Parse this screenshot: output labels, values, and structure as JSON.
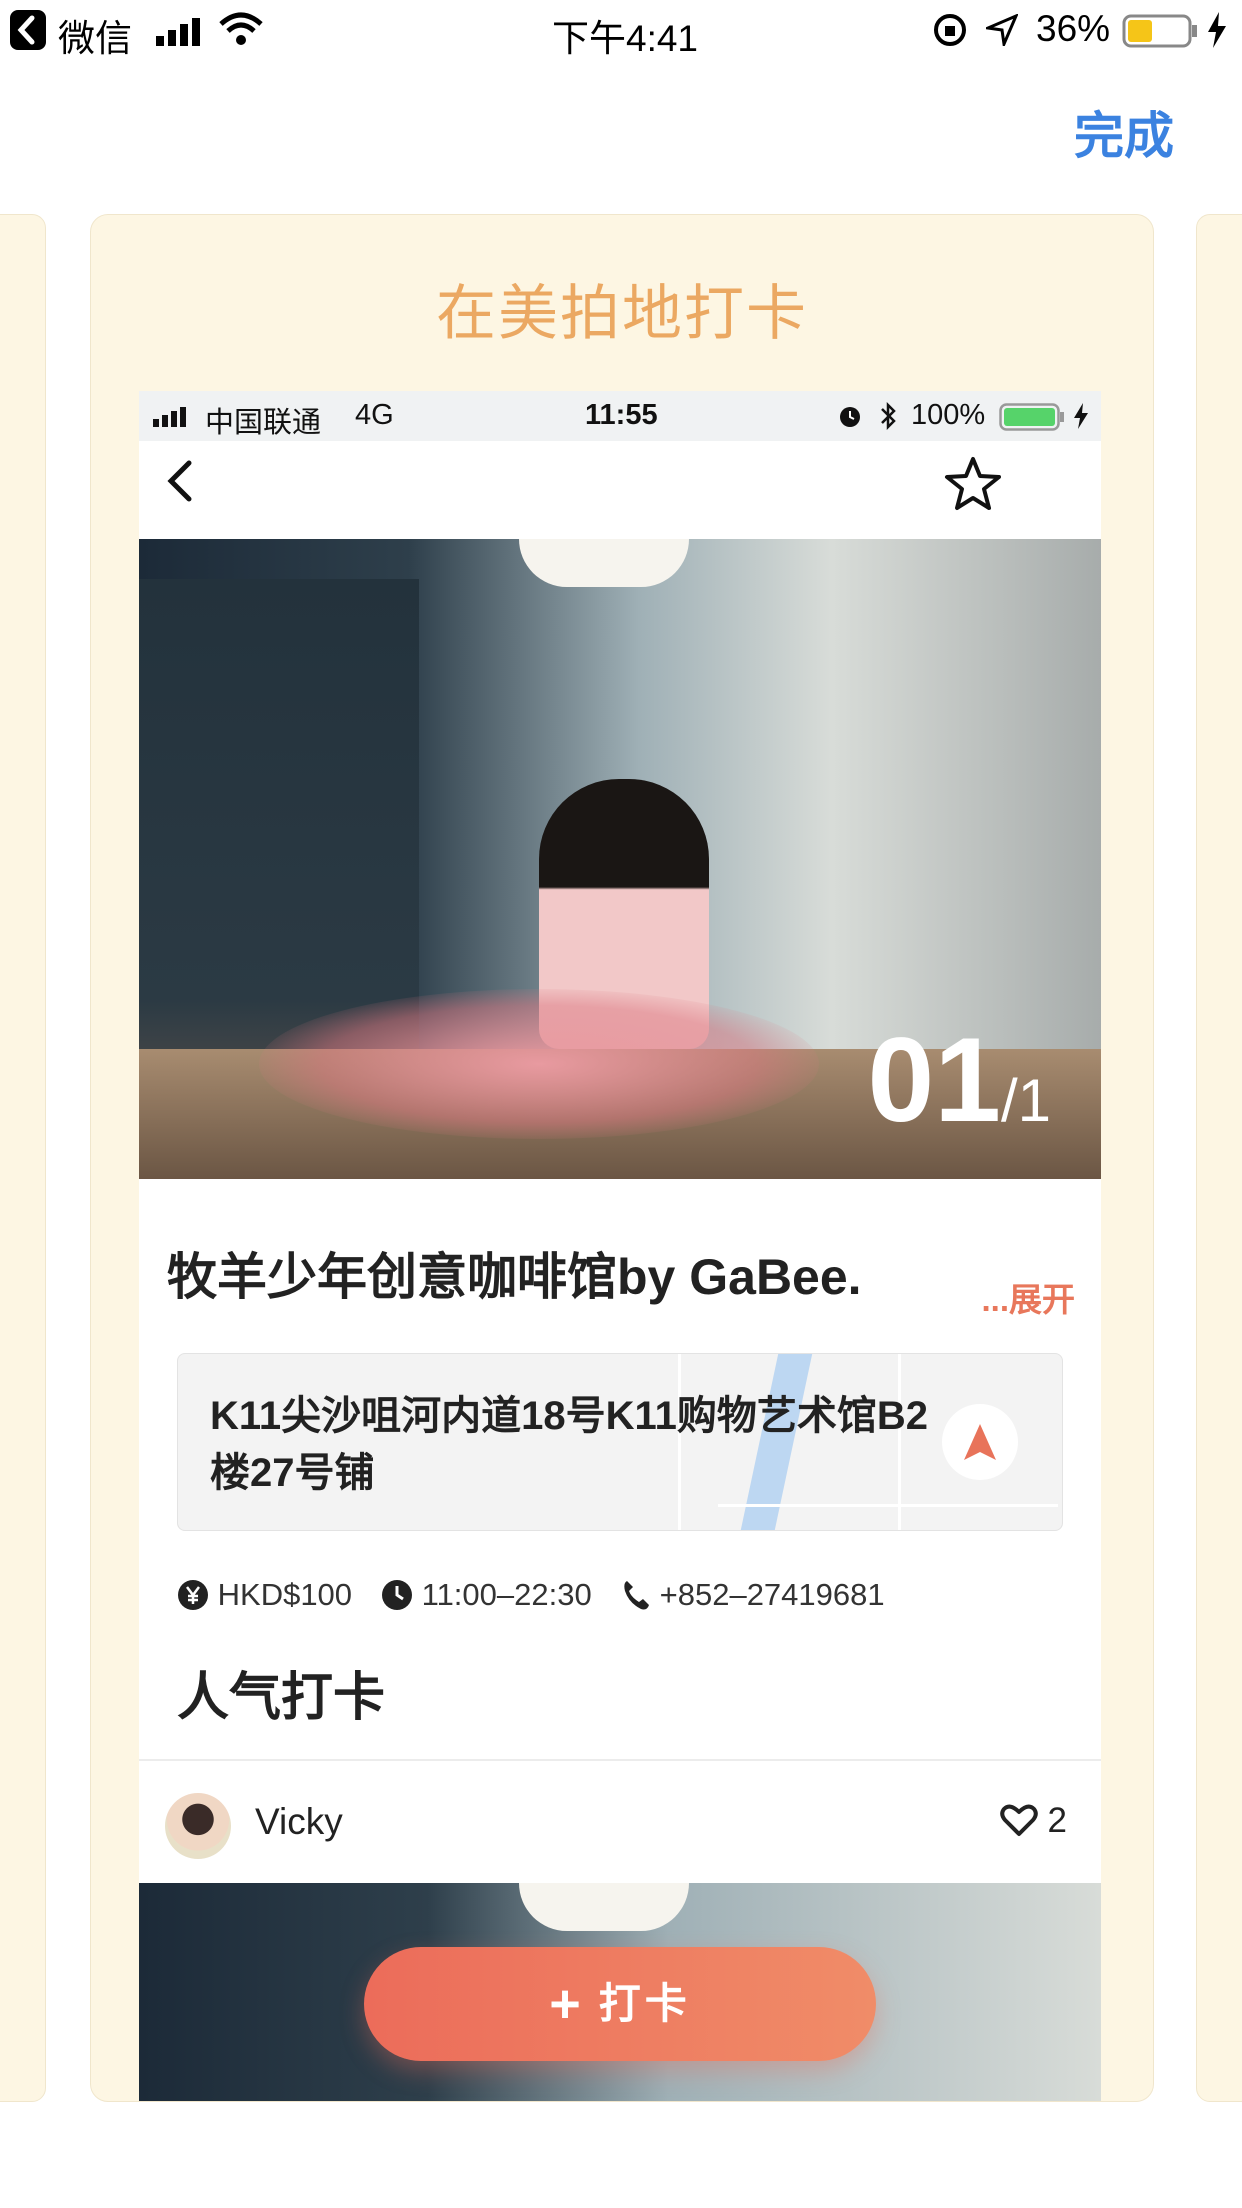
{
  "status_bar": {
    "back_app": "微信",
    "time": "下午4:41",
    "battery": "36%"
  },
  "header": {
    "done_label": "完成"
  },
  "card": {
    "title": "在美拍地打卡",
    "inner_status": {
      "carrier": "中国联通",
      "network": "4G",
      "time": "11:55",
      "battery": "100%"
    },
    "photo_counter": {
      "current": "01",
      "total": "/1"
    },
    "shop_name": "牧羊少年创意咖啡馆by GaBee.",
    "expand_label": "...展开",
    "address": "K11尖沙咀河内道18号K11购物艺术馆B2楼27号铺",
    "price": "HKD$100",
    "hours": "11:00–22:30",
    "phone": "+852–27419681",
    "section_title": "人气打卡",
    "post": {
      "user": "Vicky",
      "likes": "2"
    }
  },
  "checkin_button": {
    "label": "打卡"
  },
  "colors": {
    "accent": "#ec6c5a",
    "card_bg": "#fdf6e3",
    "title": "#eba862",
    "link_blue": "#3b82e0"
  }
}
